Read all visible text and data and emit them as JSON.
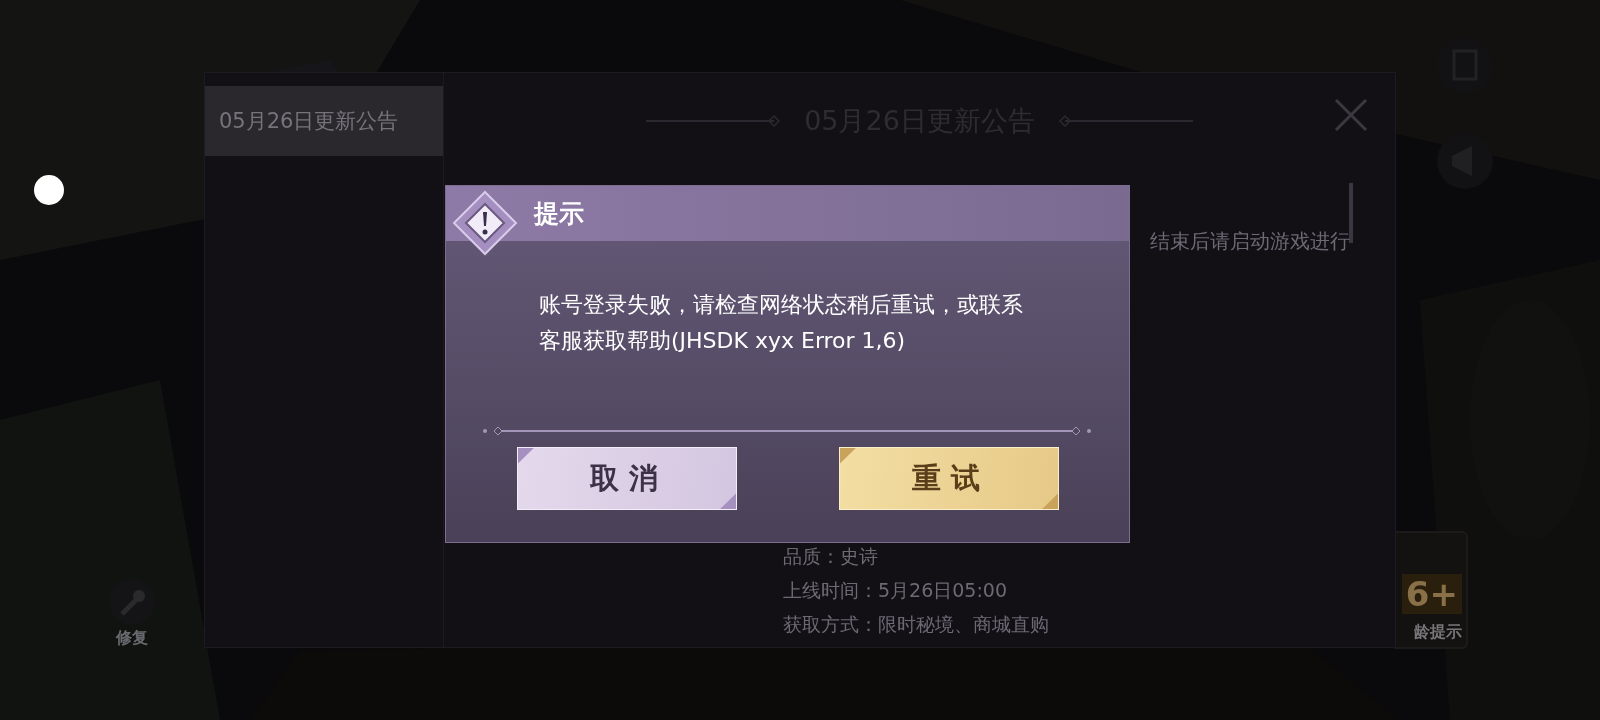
{
  "notice": {
    "tabs": [
      {
        "label": "05月26日更新公告",
        "selected": true
      }
    ],
    "title": "05月26日更新公告",
    "fragments": [
      {
        "text": "结束后请启动游戏进行",
        "kind": "top"
      },
      {
        "text": "品质：史诗",
        "kind": "line"
      },
      {
        "text": "上线时间：5月26日05:00",
        "kind": "line"
      },
      {
        "text": "获取方式：限时秘境、商城直购",
        "kind": "line"
      }
    ]
  },
  "side_buttons": [
    {
      "label": "修复"
    }
  ],
  "age_badge": {
    "rating": "6+",
    "label": "龄提示"
  },
  "dialog": {
    "title": "提示",
    "message": "账号登录失败，请检查网络状态稍后重试，或联系客服获取帮助(JHSDK xyx Error 1,6)",
    "buttons": [
      {
        "label": "取消",
        "kind": "secondary"
      },
      {
        "label": "重试",
        "kind": "primary"
      }
    ]
  }
}
